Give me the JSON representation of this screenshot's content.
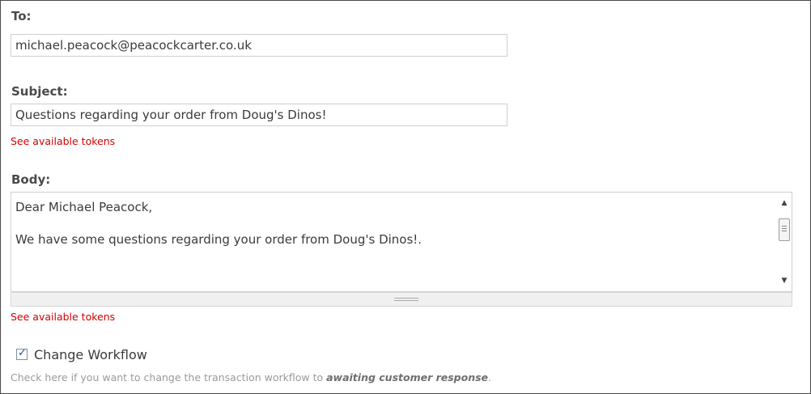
{
  "to": {
    "label": "To:",
    "value": "michael.peacock@peacockcarter.co.uk"
  },
  "subject": {
    "label": "Subject:",
    "value": "Questions regarding your order from Doug's Dinos!",
    "tokens_link": "See available tokens"
  },
  "body": {
    "label": "Body:",
    "value": "Dear Michael Peacock,\n\nWe have some questions regarding your order from Doug's Dinos!.",
    "tokens_link": "See available tokens"
  },
  "workflow": {
    "checked": true,
    "label": "Change Workflow",
    "help_prefix": "Check here if you want to change the transaction workflow to ",
    "help_emphasis": "awaiting customer response",
    "help_suffix": "."
  },
  "colors": {
    "token_link": "#d40000",
    "label": "#4a4a4a",
    "checkmark": "#2a3ea8"
  },
  "icons": {
    "scroll_up": "arrow-up-icon",
    "scroll_down": "arrow-down-icon",
    "check": "checkmark-icon"
  }
}
